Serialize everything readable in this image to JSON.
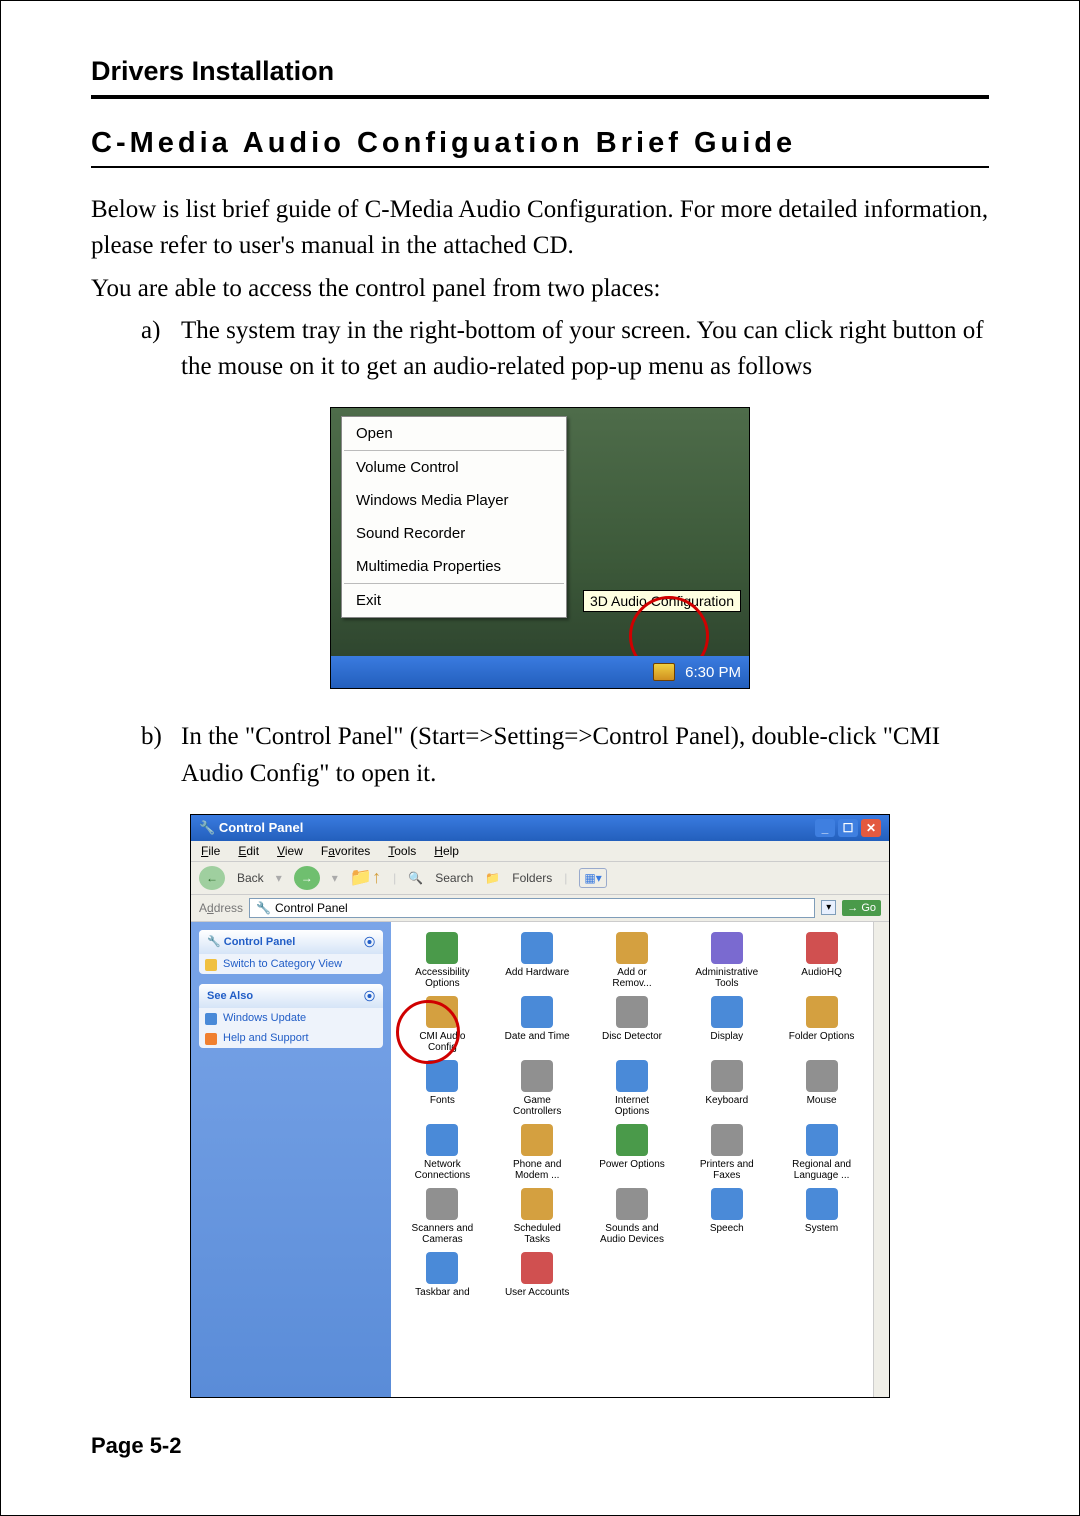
{
  "section_title": "Drivers Installation",
  "heading": "C-Media Audio Configuation Brief Guide",
  "para1": "Below is list brief guide of C-Media Audio Configuration.  For more detailed information, please refer to user's manual in the attached CD.",
  "para2": "You are able to access the control panel from two places:",
  "item_a_marker": "a)",
  "item_a": "The system tray in the right-bottom of your screen. You can click right button of the mouse on it to get an audio-related pop-up menu as follows",
  "item_b_marker": "b)",
  "item_b": "In the \"Control Panel\" (Start=>Setting=>Control Panel), double-click \"CMI Audio Config\" to open it.",
  "popup": {
    "open": "Open",
    "vol": "Volume Control",
    "wmp": "Windows Media Player",
    "sr": "Sound Recorder",
    "mp": "Multimedia Properties",
    "exit": "Exit"
  },
  "tooltip": "3D Audio Configuration",
  "clock": "6:30 PM",
  "cp": {
    "title": "Control Panel",
    "menu": {
      "file": "File",
      "edit": "Edit",
      "view": "View",
      "favorites": "Favorites",
      "tools": "Tools",
      "help": "Help"
    },
    "toolbar": {
      "back": "Back",
      "search": "Search",
      "folders": "Folders"
    },
    "address_label": "Address",
    "address_value": "Control Panel",
    "go": "Go",
    "side1_title": "Control Panel",
    "side1_link": "Switch to Category View",
    "side2_title": "See Also",
    "side2_link1": "Windows Update",
    "side2_link2": "Help and Support",
    "icons": [
      {
        "label": "Accessibility\nOptions",
        "color": "#4a9a4a"
      },
      {
        "label": "Add Hardware",
        "color": "#4a8ad8"
      },
      {
        "label": "Add or\nRemov...",
        "color": "#d4a040"
      },
      {
        "label": "Administrative\nTools",
        "color": "#7a6ad0"
      },
      {
        "label": "AudioHQ",
        "color": "#d05050"
      },
      {
        "label": "CMI Audio\nConfig",
        "color": "#d4a040"
      },
      {
        "label": "Date and Time",
        "color": "#4a8ad8"
      },
      {
        "label": "Disc Detector",
        "color": "#909090"
      },
      {
        "label": "Display",
        "color": "#4a8ad8"
      },
      {
        "label": "Folder Options",
        "color": "#d4a040"
      },
      {
        "label": "Fonts",
        "color": "#4a8ad8"
      },
      {
        "label": "Game\nControllers",
        "color": "#909090"
      },
      {
        "label": "Internet\nOptions",
        "color": "#4a8ad8"
      },
      {
        "label": "Keyboard",
        "color": "#909090"
      },
      {
        "label": "Mouse",
        "color": "#909090"
      },
      {
        "label": "Network\nConnections",
        "color": "#4a8ad8"
      },
      {
        "label": "Phone and\nModem ...",
        "color": "#d4a040"
      },
      {
        "label": "Power Options",
        "color": "#4a9a4a"
      },
      {
        "label": "Printers and\nFaxes",
        "color": "#909090"
      },
      {
        "label": "Regional and\nLanguage ...",
        "color": "#4a8ad8"
      },
      {
        "label": "Scanners and\nCameras",
        "color": "#909090"
      },
      {
        "label": "Scheduled\nTasks",
        "color": "#d4a040"
      },
      {
        "label": "Sounds and\nAudio Devices",
        "color": "#909090"
      },
      {
        "label": "Speech",
        "color": "#4a8ad8"
      },
      {
        "label": "System",
        "color": "#4a8ad8"
      },
      {
        "label": "Taskbar and",
        "color": "#4a8ad8"
      },
      {
        "label": "User Accounts",
        "color": "#d05050"
      }
    ]
  },
  "page_number": "Page 5-2"
}
